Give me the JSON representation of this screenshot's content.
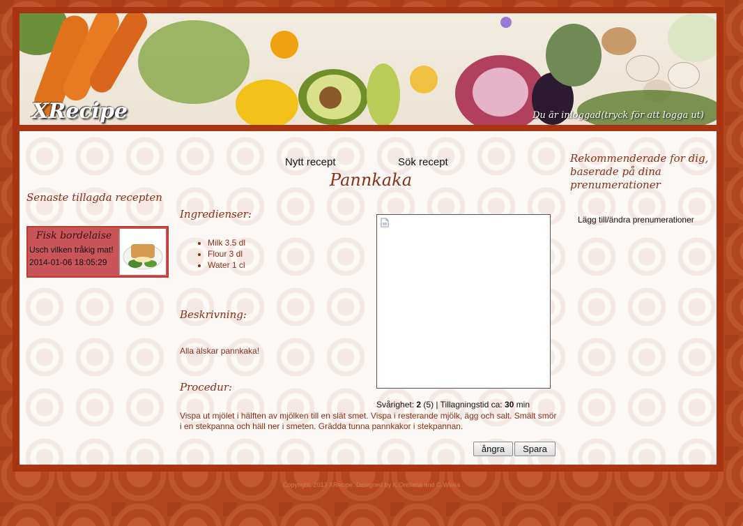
{
  "header": {
    "logo": "XRecipe",
    "login_status": "Du är inloggad(tryck för att logga ut)"
  },
  "nav": {
    "new_recipe": "Nytt recept",
    "search_recipe": "Sök recept"
  },
  "left": {
    "title": "Senaste tillagda recepten",
    "recipes": [
      {
        "name": "Fisk bordelaise",
        "description": "Usch vilken tråkig mat!",
        "date": "2014-01-06 18:05:29"
      }
    ]
  },
  "recipe": {
    "title": "Pannkaka",
    "ingredients_heading": "Ingredienser:",
    "ingredients": [
      "Milk 3.5 dl",
      "Flour 3 dl",
      "Water 1 cl"
    ],
    "description_heading": "Beskrivning:",
    "description": "Alla älskar pannkaka!",
    "procedure_heading": "Procedur:",
    "procedure": "Vispa ut mjölet i hälften av mjölken till en slät smet. Vispa i resterande mjölk, ägg och salt. Smält smör i en stekpanna och häll ner i smeten. Grädda tunna pannkakor i stekpannan.",
    "difficulty_label": "Svårighet:",
    "difficulty": "2",
    "difficulty_max": "(5)",
    "separator": "|",
    "time_label": "Tillagningstid ca:",
    "time": "30",
    "time_unit": "min"
  },
  "buttons": {
    "undo": "ångra",
    "save": "Spara"
  },
  "right": {
    "title": "Rekommenderade for dig, baserade på dina prenumerationer",
    "subscriptions_link": "Lägg till/ändra prenumerationer"
  },
  "footer": {
    "text": "Copyright, 2013 XRecipe. Designed by K.Orellana and G.Wiiala"
  },
  "colors": {
    "background": "#b4461c",
    "frame": "#a83412",
    "accent_text": "#8b2d12",
    "card": "#c9555b"
  }
}
